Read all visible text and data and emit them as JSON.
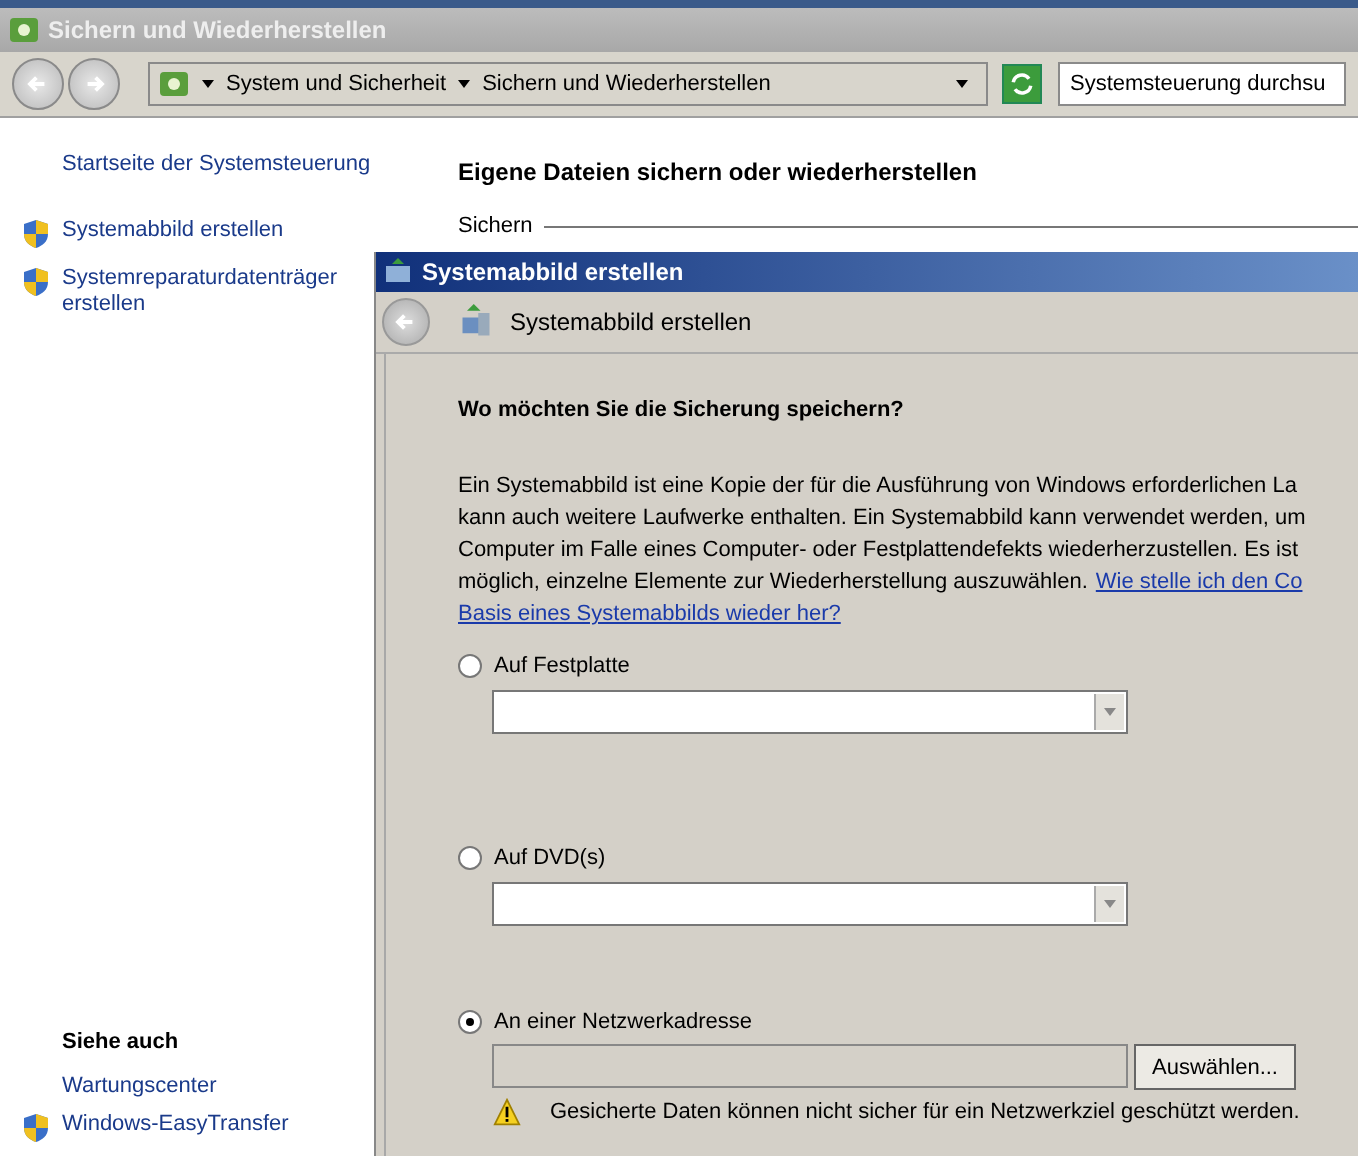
{
  "window": {
    "title": "Sichern und Wiederherstellen"
  },
  "address_bar": {
    "crumbs": [
      "System und Sicherheit",
      "Sichern und Wiederherstellen"
    ],
    "search_placeholder": "Systemsteuerung durchsu"
  },
  "sidebar": {
    "home_link": "Startseite der Systemsteuerung",
    "tasks": [
      {
        "label": "Systemabbild erstellen"
      },
      {
        "label": "Systemreparaturdatenträger erstellen"
      }
    ],
    "see_also_heading": "Siehe auch",
    "see_also": [
      {
        "label": "Wartungscenter",
        "shield": false
      },
      {
        "label": "Windows-EasyTransfer",
        "shield": true
      }
    ]
  },
  "main": {
    "heading": "Eigene Dateien sichern oder wiederherstellen",
    "section": "Sichern"
  },
  "dialog": {
    "title": "Systemabbild erstellen",
    "header": "Systemabbild erstellen",
    "question": "Wo möchten Sie die Sicherung speichern?",
    "description_lines": [
      "Ein Systemabbild ist eine Kopie der für die Ausführung von Windows erforderlichen La",
      "kann auch weitere Laufwerke enthalten. Ein Systemabbild kann verwendet werden, um",
      "Computer im Falle eines Computer- oder Festplattendefekts wiederherzustellen. Es ist",
      "möglich, einzelne Elemente zur Wiederherstellung auszuwählen."
    ],
    "link_lines": [
      "Wie stelle ich den Co",
      "Basis eines Systemabbilds wieder her?"
    ],
    "options": [
      {
        "kind": "dropdown",
        "label": "Auf Festplatte",
        "selected": false
      },
      {
        "kind": "dropdown",
        "label": "Auf DVD(s)",
        "selected": false
      },
      {
        "kind": "network",
        "label": "An einer Netzwerkadresse",
        "selected": true,
        "button": "Auswählen...",
        "warning": "Gesicherte Daten können nicht sicher für ein Netzwerkziel geschützt werden."
      }
    ]
  }
}
